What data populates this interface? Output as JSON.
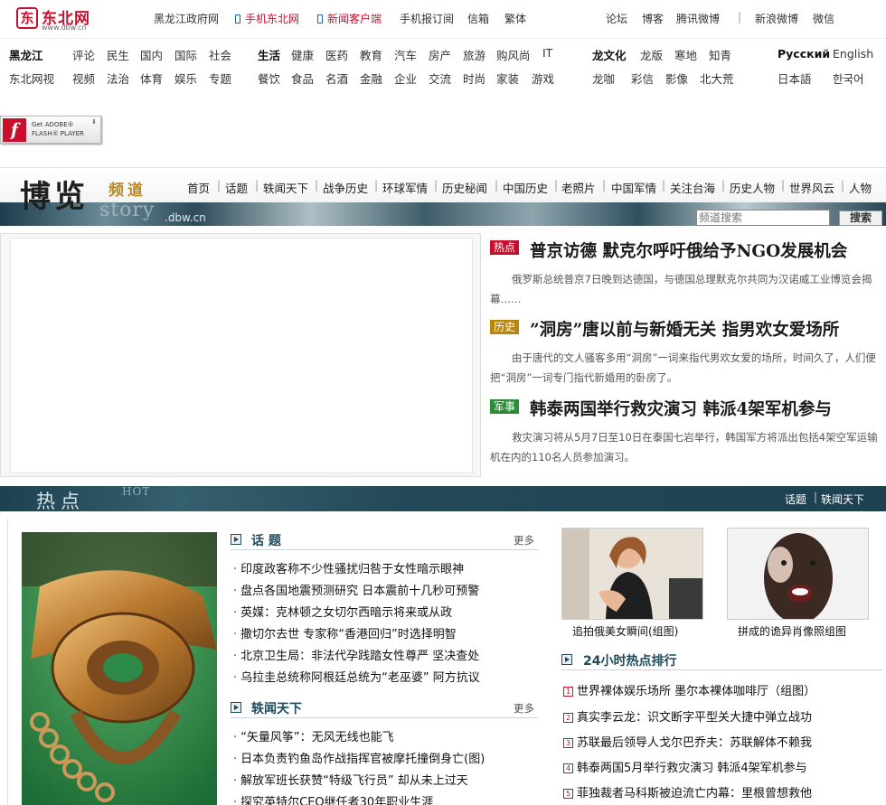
{
  "top": {
    "logo_mark": "东",
    "logo_name": "东北网",
    "logo_url": "www.dbw.cn",
    "links_left": [
      "黑龙江政府网",
      "手机东北网",
      "新闻客户端",
      "手机报订阅",
      "信箱",
      "繁体"
    ],
    "links_right": [
      "论坛",
      "博客",
      "腾讯微博",
      "|",
      "新浪微博",
      "微信"
    ]
  },
  "nav": {
    "row1_heilongjiang": [
      "黑龙江",
      "评论",
      "民生",
      "国内",
      "国际",
      "社会"
    ],
    "row2_dongbei": [
      "东北网视",
      "视频",
      "法治",
      "体育",
      "娱乐",
      "专题"
    ],
    "row1_life": [
      "生活",
      "健康",
      "医药",
      "教育",
      "汽车",
      "房产",
      "旅游",
      "购风尚",
      "IT"
    ],
    "row2_life": [
      "餐饮",
      "食品",
      "名酒",
      "金融",
      "企业",
      "交流",
      "时尚",
      "家装",
      "游戏"
    ],
    "row1_culture": [
      "龙文化",
      "龙版",
      "寒地",
      "知青"
    ],
    "row2_culture": [
      "龙咖",
      "彩信",
      "影像",
      "北大荒"
    ],
    "lang_row1": [
      "Русский",
      "English"
    ],
    "lang_row2": [
      "日本語",
      "한국어"
    ]
  },
  "flash": {
    "icon": "f",
    "line1": "Get ADOBE®",
    "line2": "FLASH® PLAYER",
    "download": "⬇"
  },
  "channel": {
    "title": "博览",
    "subtitle": "频道",
    "story": "story",
    "domain": ".dbw.cn",
    "links": [
      "首页",
      "话题",
      "轶闻天下",
      "战争历史",
      "环球军情",
      "历史秘闻",
      "中国历史",
      "老照片",
      "中国军情",
      "关注台海",
      "历史人物",
      "世界风云",
      "人物"
    ],
    "search_placeholder": "频道搜索",
    "search_button": "搜索"
  },
  "headlines": [
    {
      "tag": "热点",
      "tag_color": "#c8102e",
      "title": "普京访德  默克尔呼吁俄给予NGO发展机会",
      "summary": "俄罗斯总统普京7日晚到达德国，与德国总理默克尔共同为汉诺威工业博览会揭幕……"
    },
    {
      "tag": "历史",
      "tag_color": "#b8860b",
      "title": "”洞房”唐以前与新婚无关  指男欢女爱场所",
      "summary": "由于唐代的文人骚客多用“洞房”一词来指代男欢女爱的场所，时间久了，人们便把“洞房”一词专门指代新婚用的卧房了。"
    },
    {
      "tag": "军事",
      "tag_color": "#2e8b3a",
      "title": "韩泰两国举行救灾演习  韩派4架军机参与",
      "summary": "救灾演习将从5月7日至10日在泰国七岩举行，韩国军方将派出包括4架空军运输机在内的110名人员参加演习。"
    }
  ],
  "hot": {
    "title": "热点",
    "en": "HOT",
    "link1": "话题",
    "sep": "|",
    "link2": "轶闻天下"
  },
  "topics": {
    "title": "话 题",
    "more": "更多",
    "items": [
      "印度政客称不少性骚扰归咎于女性暗示眼神",
      "盘点各国地震预测研究 日本震前十几秒可预警",
      "英媒：克林顿之女切尔西暗示将来或从政",
      "撒切尔去世 专家称“香港回归”时选择明智",
      "北京卫生局：非法代孕践踏女性尊严 坚决查处",
      "乌拉圭总统称阿根廷总统为“老巫婆” 阿方抗议"
    ]
  },
  "anecdotes": {
    "title": "轶闻天下",
    "more": "更多",
    "items": [
      "“矢量风筝”：无风无线也能飞",
      "日本负责钓鱼岛作战指挥官被摩托撞倒身亡(图)",
      "解放军班长获赞“特级飞行员” 却从未上过天",
      "探究英特尔CEO继任者30年职业生涯"
    ]
  },
  "photos": [
    {
      "caption": "追拍俄美女瞬间(组图)"
    },
    {
      "caption": "拼成的诡异肖像照组图"
    }
  ],
  "ranking": {
    "title": "24小时热点排行",
    "items": [
      {
        "n": "1",
        "text": "世界裸体娱乐场所 墨尔本裸体咖啡厅（组图）"
      },
      {
        "n": "2",
        "text": "真实李云龙：识文断字平型关大捷中弹立战功"
      },
      {
        "n": "3",
        "text": "苏联最后领导人戈尔巴乔夫：苏联解体不赖我"
      },
      {
        "n": "4",
        "text": "韩泰两国5月举行救灾演习 韩派4架军机参与"
      },
      {
        "n": "5",
        "text": "菲独裁者马科斯被迫流亡内幕：里根曾想救他"
      }
    ]
  }
}
